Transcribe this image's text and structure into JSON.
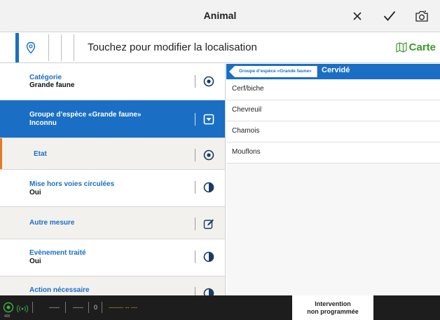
{
  "header": {
    "title": "Animal",
    "close_icon": "close-icon",
    "confirm_icon": "check-icon",
    "camera_icon": "camera-icon"
  },
  "location": {
    "text": "Touchez pour modifier la localisation",
    "map_label": "Carte",
    "accent_color": "#1a6fc4",
    "map_color": "#3a9a2a"
  },
  "fields": [
    {
      "label": "Catégorie",
      "value": "Grande faune",
      "icon": "target-icon"
    },
    {
      "label": "Groupe d’espèce «Grande faune»",
      "value": "Inconnu",
      "icon": "dropdown-square-icon"
    },
    {
      "label": "Etat",
      "value": "",
      "icon": "target-icon"
    },
    {
      "label": "Mise hors voies circulées",
      "value": "Oui",
      "icon": "half-circle-icon"
    },
    {
      "label": "Autre mesure",
      "value": "",
      "icon": "edit-icon"
    },
    {
      "label": "Evènement traité",
      "value": "Oui",
      "icon": "half-circle-icon"
    },
    {
      "label": "Action nécessaire",
      "value": "",
      "icon": "half-circle-icon"
    }
  ],
  "picker": {
    "breadcrumb": "Groupe d’espèce «Grande faune»",
    "current": "Cervidé",
    "options": [
      "Cerf/biche",
      "Chevreuil",
      "Chamois",
      "Mouflons"
    ]
  },
  "status": {
    "gps_sub": "400",
    "field1": "-----",
    "field2": "-----",
    "count": "0",
    "time": "------- -- ---",
    "intervention_line1": "Intervention",
    "intervention_line2": "non programmée",
    "gps_color": "#3cb043",
    "time_color": "#e0a020"
  }
}
